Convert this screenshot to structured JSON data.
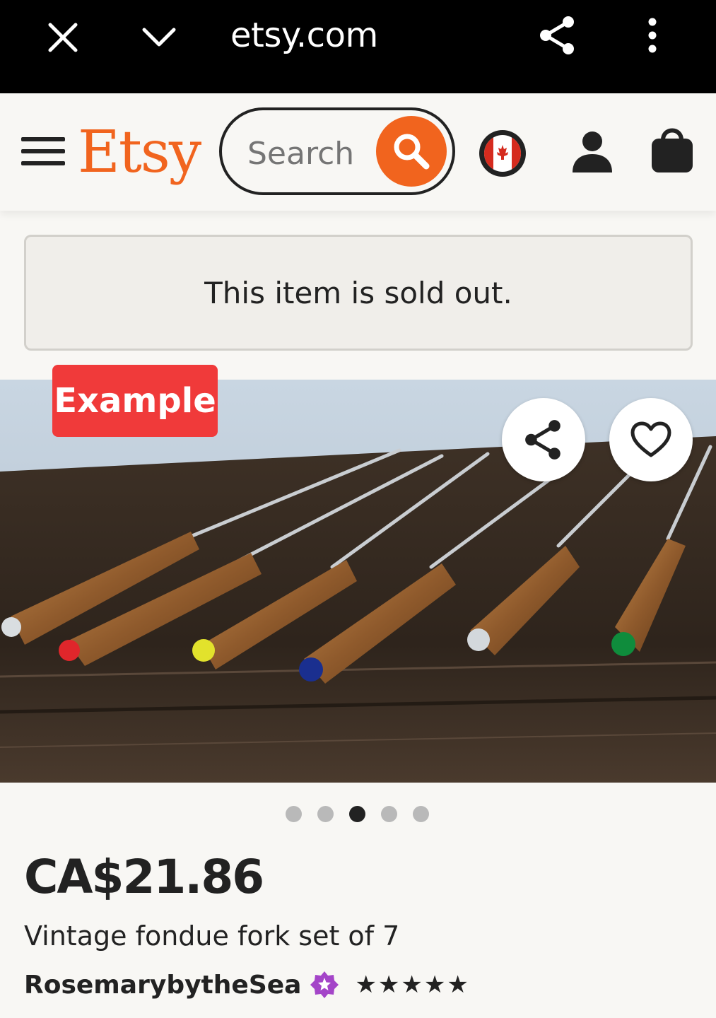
{
  "browser": {
    "url": "etsy.com"
  },
  "header": {
    "logo": "Etsy",
    "search_placeholder": "Search"
  },
  "notice": {
    "text": "This item is sold out."
  },
  "listing": {
    "badge": "Example",
    "carousel": {
      "total": 5,
      "active_index": 2
    },
    "price": "CA$21.86",
    "title": "Vintage fondue fork set of 7",
    "shop_name": "RosemarybytheSea",
    "rating_stars": "★★★★★"
  },
  "colors": {
    "brand_orange": "#f1641e",
    "badge_red": "#f03a3a",
    "star_seller_purple": "#a445c8"
  },
  "icons": [
    "close-icon",
    "chevron-down-icon",
    "share-icon",
    "more-vert-icon",
    "menu-icon",
    "search-icon",
    "canada-flag-icon",
    "user-icon",
    "shopping-bag-icon",
    "heart-icon",
    "star-seller-icon"
  ]
}
